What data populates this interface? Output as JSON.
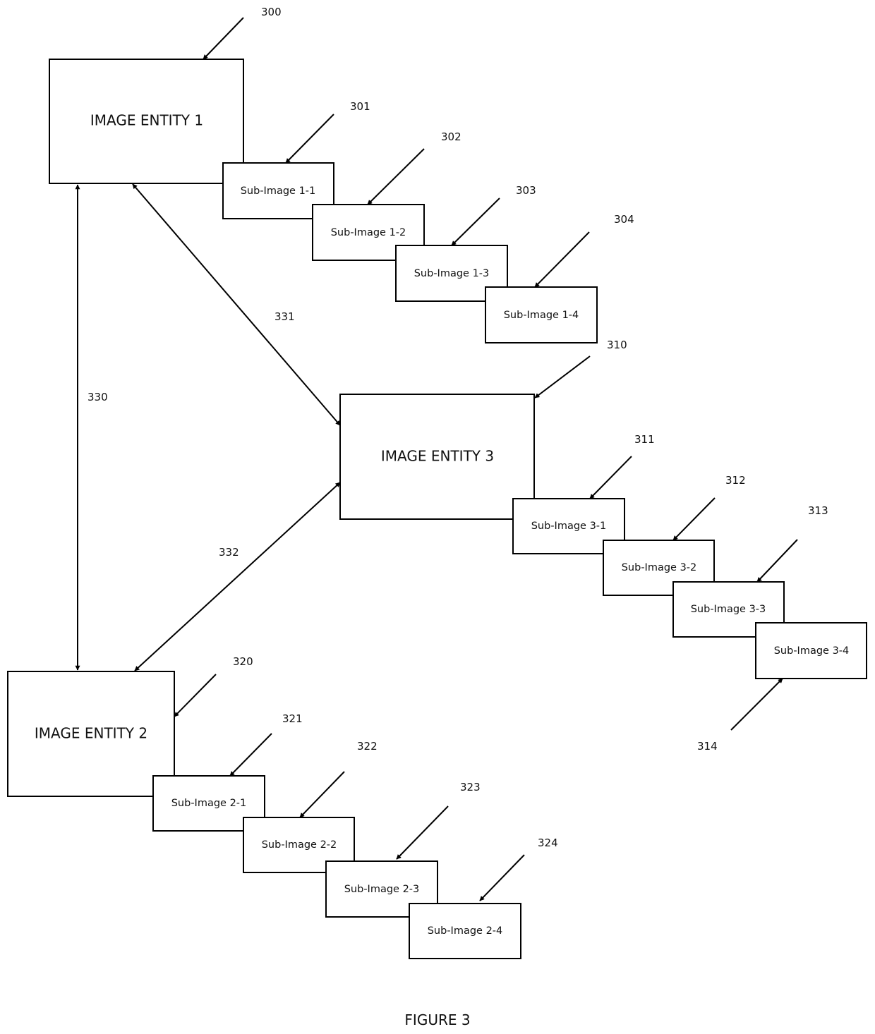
{
  "figure_caption": "FIGURE 3",
  "entities": [
    {
      "id": "entity-1",
      "label": "IMAGE ENTITY 1",
      "ref": "300",
      "subimages": [
        {
          "label": "Sub-Image 1-1",
          "ref": "301"
        },
        {
          "label": "Sub-Image 1-2",
          "ref": "302"
        },
        {
          "label": "Sub-Image 1-3",
          "ref": "303"
        },
        {
          "label": "Sub-Image 1-4",
          "ref": "304"
        }
      ]
    },
    {
      "id": "entity-2",
      "label": "IMAGE ENTITY 2",
      "ref": "320",
      "subimages": [
        {
          "label": "Sub-Image 2-1",
          "ref": "321"
        },
        {
          "label": "Sub-Image 2-2",
          "ref": "322"
        },
        {
          "label": "Sub-Image 2-3",
          "ref": "323"
        },
        {
          "label": "Sub-Image 2-4",
          "ref": "324"
        }
      ]
    },
    {
      "id": "entity-3",
      "label": "IMAGE ENTITY 3",
      "ref": "310",
      "subimages": [
        {
          "label": "Sub-Image 3-1",
          "ref": "311"
        },
        {
          "label": "Sub-Image 3-2",
          "ref": "312"
        },
        {
          "label": "Sub-Image 3-3",
          "ref": "313"
        },
        {
          "label": "Sub-Image 3-4",
          "ref": "314"
        }
      ]
    }
  ],
  "connections": [
    {
      "ref": "330",
      "from": "IMAGE ENTITY 1",
      "to": "IMAGE ENTITY 2",
      "bidirectional": true
    },
    {
      "ref": "331",
      "from": "IMAGE ENTITY 1",
      "to": "IMAGE ENTITY 3",
      "bidirectional": true
    },
    {
      "ref": "332",
      "from": "IMAGE ENTITY 3",
      "to": "IMAGE ENTITY 2",
      "bidirectional": true
    }
  ]
}
